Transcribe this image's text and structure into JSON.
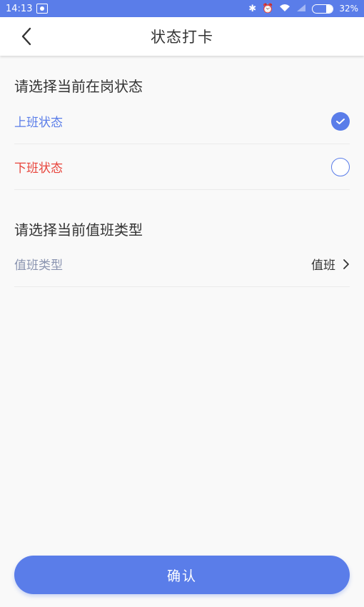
{
  "status_bar": {
    "time": "14:13",
    "battery_text": "32%",
    "battery_level": 0.32
  },
  "nav": {
    "title": "状态打卡"
  },
  "work_status": {
    "heading": "请选择当前在岗状态",
    "options": [
      {
        "label": "上班状态",
        "checked": true,
        "color": "#5a7de9"
      },
      {
        "label": "下班状态",
        "checked": false,
        "color": "#e8453c"
      }
    ]
  },
  "duty_type": {
    "heading": "请选择当前值班类型",
    "label": "值班类型",
    "value": "值班"
  },
  "footer": {
    "confirm_label": "确认"
  },
  "colors": {
    "accent": "#5a7de9",
    "muted_label": "#8a94b0"
  }
}
